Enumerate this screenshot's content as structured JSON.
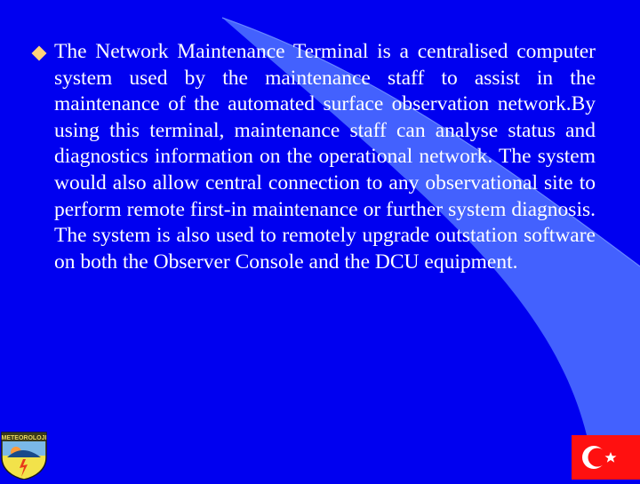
{
  "slide": {
    "bullets": [
      {
        "icon": "diamond-bullet-icon",
        "text": "The Network Maintenance Terminal is a centralised computer system used by the maintenance staff to assist in the maintenance of the automated surface observation network.By using this terminal, maintenance staff can analyse status and diagnostics information on the operational network. The system would also allow central connection to any observational site to perform remote first-in maintenance or further system diagnosis. The system is also used to remotely upgrade outstation software on both the Observer Console and the DCU equipment."
      }
    ]
  },
  "logo": {
    "label": "METEOROLOJI",
    "icon": "meteorology-emblem-icon"
  },
  "flag": {
    "icon": "turkish-flag-icon"
  },
  "colors": {
    "background": "#0000f0",
    "swoosh": "#4a6cff",
    "text": "#ffffff",
    "bullet": "#ffd27a",
    "flag_red": "#ff1010"
  }
}
